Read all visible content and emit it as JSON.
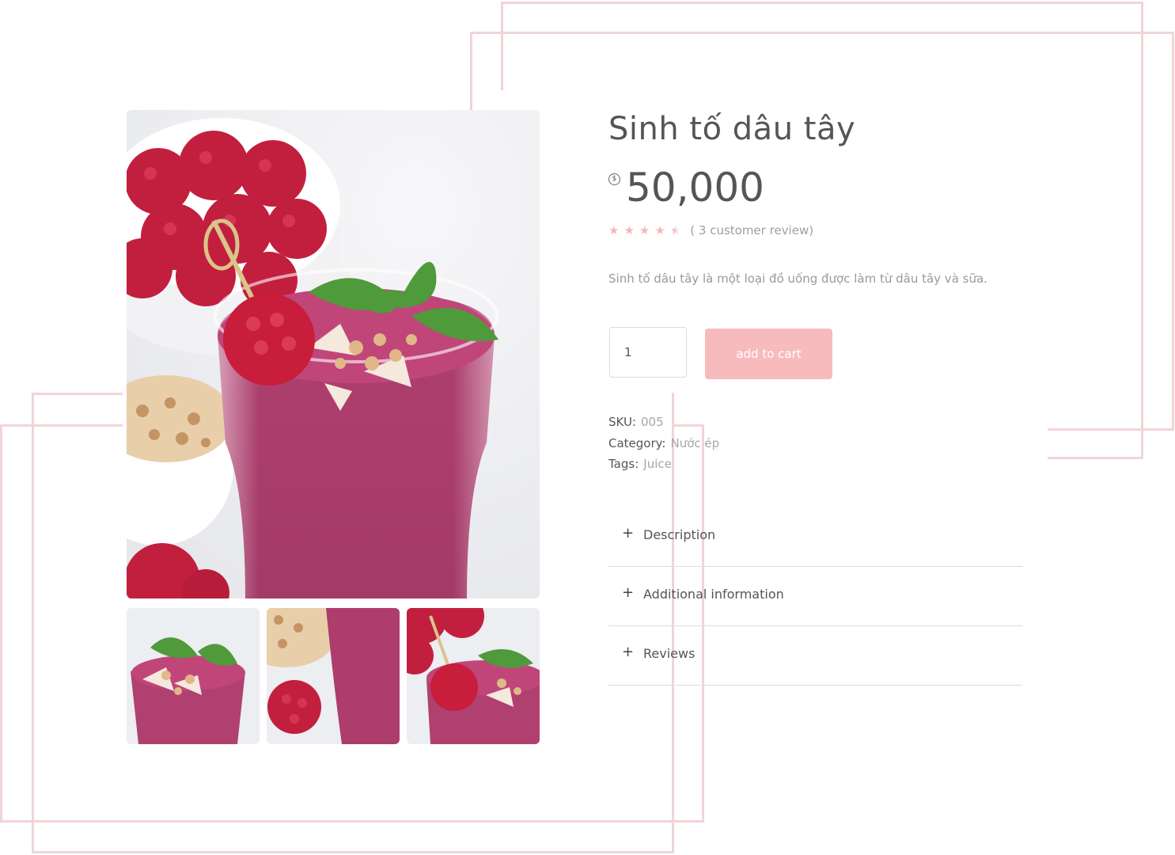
{
  "product": {
    "title": "Sinh tố dâu tây",
    "currency_symbol": "$",
    "price": "50,000",
    "rating": 4.5,
    "review_text": "( 3 customer review)",
    "description": "Sinh tố dâu tây là một loại đồ uống được làm từ dâu tây và sữa.",
    "quantity": "1",
    "add_to_cart_label": "add to cart",
    "sku_label": "SKU:",
    "sku_value": "005",
    "category_label": "Category:",
    "category_value": "Nước ép",
    "tags_label": "Tags:",
    "tags_value": "Juice"
  },
  "accordion": [
    {
      "label": "Description"
    },
    {
      "label": "Additional information"
    },
    {
      "label": "Reviews"
    }
  ],
  "colors": {
    "accent": "#f8bbbd",
    "frame": "#f2d4d6",
    "star": "#f6b6b7"
  }
}
